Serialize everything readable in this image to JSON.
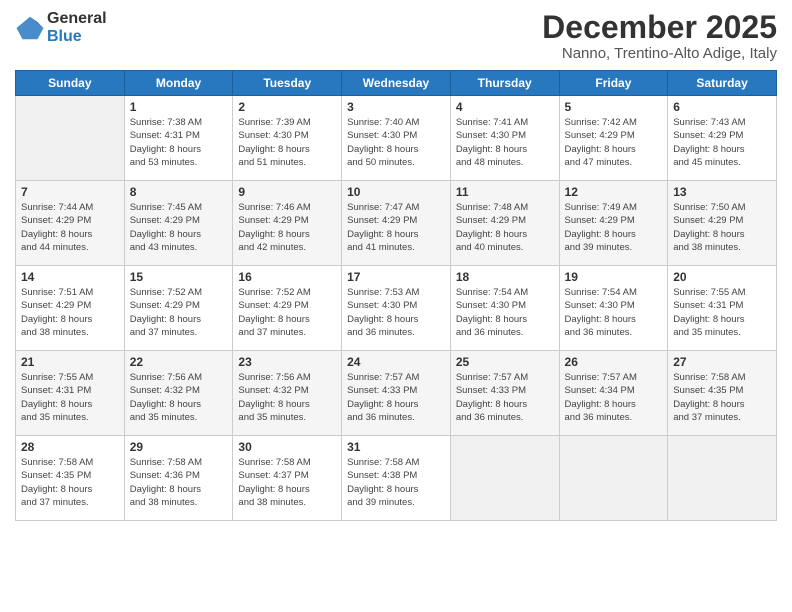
{
  "logo": {
    "general": "General",
    "blue": "Blue"
  },
  "header": {
    "title": "December 2025",
    "subtitle": "Nanno, Trentino-Alto Adige, Italy"
  },
  "weekdays": [
    "Sunday",
    "Monday",
    "Tuesday",
    "Wednesday",
    "Thursday",
    "Friday",
    "Saturday"
  ],
  "weeks": [
    [
      {
        "day": "",
        "info": ""
      },
      {
        "day": "1",
        "info": "Sunrise: 7:38 AM\nSunset: 4:31 PM\nDaylight: 8 hours\nand 53 minutes."
      },
      {
        "day": "2",
        "info": "Sunrise: 7:39 AM\nSunset: 4:30 PM\nDaylight: 8 hours\nand 51 minutes."
      },
      {
        "day": "3",
        "info": "Sunrise: 7:40 AM\nSunset: 4:30 PM\nDaylight: 8 hours\nand 50 minutes."
      },
      {
        "day": "4",
        "info": "Sunrise: 7:41 AM\nSunset: 4:30 PM\nDaylight: 8 hours\nand 48 minutes."
      },
      {
        "day": "5",
        "info": "Sunrise: 7:42 AM\nSunset: 4:29 PM\nDaylight: 8 hours\nand 47 minutes."
      },
      {
        "day": "6",
        "info": "Sunrise: 7:43 AM\nSunset: 4:29 PM\nDaylight: 8 hours\nand 45 minutes."
      }
    ],
    [
      {
        "day": "7",
        "info": "Sunrise: 7:44 AM\nSunset: 4:29 PM\nDaylight: 8 hours\nand 44 minutes."
      },
      {
        "day": "8",
        "info": "Sunrise: 7:45 AM\nSunset: 4:29 PM\nDaylight: 8 hours\nand 43 minutes."
      },
      {
        "day": "9",
        "info": "Sunrise: 7:46 AM\nSunset: 4:29 PM\nDaylight: 8 hours\nand 42 minutes."
      },
      {
        "day": "10",
        "info": "Sunrise: 7:47 AM\nSunset: 4:29 PM\nDaylight: 8 hours\nand 41 minutes."
      },
      {
        "day": "11",
        "info": "Sunrise: 7:48 AM\nSunset: 4:29 PM\nDaylight: 8 hours\nand 40 minutes."
      },
      {
        "day": "12",
        "info": "Sunrise: 7:49 AM\nSunset: 4:29 PM\nDaylight: 8 hours\nand 39 minutes."
      },
      {
        "day": "13",
        "info": "Sunrise: 7:50 AM\nSunset: 4:29 PM\nDaylight: 8 hours\nand 38 minutes."
      }
    ],
    [
      {
        "day": "14",
        "info": "Sunrise: 7:51 AM\nSunset: 4:29 PM\nDaylight: 8 hours\nand 38 minutes."
      },
      {
        "day": "15",
        "info": "Sunrise: 7:52 AM\nSunset: 4:29 PM\nDaylight: 8 hours\nand 37 minutes."
      },
      {
        "day": "16",
        "info": "Sunrise: 7:52 AM\nSunset: 4:29 PM\nDaylight: 8 hours\nand 37 minutes."
      },
      {
        "day": "17",
        "info": "Sunrise: 7:53 AM\nSunset: 4:30 PM\nDaylight: 8 hours\nand 36 minutes."
      },
      {
        "day": "18",
        "info": "Sunrise: 7:54 AM\nSunset: 4:30 PM\nDaylight: 8 hours\nand 36 minutes."
      },
      {
        "day": "19",
        "info": "Sunrise: 7:54 AM\nSunset: 4:30 PM\nDaylight: 8 hours\nand 36 minutes."
      },
      {
        "day": "20",
        "info": "Sunrise: 7:55 AM\nSunset: 4:31 PM\nDaylight: 8 hours\nand 35 minutes."
      }
    ],
    [
      {
        "day": "21",
        "info": "Sunrise: 7:55 AM\nSunset: 4:31 PM\nDaylight: 8 hours\nand 35 minutes."
      },
      {
        "day": "22",
        "info": "Sunrise: 7:56 AM\nSunset: 4:32 PM\nDaylight: 8 hours\nand 35 minutes."
      },
      {
        "day": "23",
        "info": "Sunrise: 7:56 AM\nSunset: 4:32 PM\nDaylight: 8 hours\nand 35 minutes."
      },
      {
        "day": "24",
        "info": "Sunrise: 7:57 AM\nSunset: 4:33 PM\nDaylight: 8 hours\nand 36 minutes."
      },
      {
        "day": "25",
        "info": "Sunrise: 7:57 AM\nSunset: 4:33 PM\nDaylight: 8 hours\nand 36 minutes."
      },
      {
        "day": "26",
        "info": "Sunrise: 7:57 AM\nSunset: 4:34 PM\nDaylight: 8 hours\nand 36 minutes."
      },
      {
        "day": "27",
        "info": "Sunrise: 7:58 AM\nSunset: 4:35 PM\nDaylight: 8 hours\nand 37 minutes."
      }
    ],
    [
      {
        "day": "28",
        "info": "Sunrise: 7:58 AM\nSunset: 4:35 PM\nDaylight: 8 hours\nand 37 minutes."
      },
      {
        "day": "29",
        "info": "Sunrise: 7:58 AM\nSunset: 4:36 PM\nDaylight: 8 hours\nand 38 minutes."
      },
      {
        "day": "30",
        "info": "Sunrise: 7:58 AM\nSunset: 4:37 PM\nDaylight: 8 hours\nand 38 minutes."
      },
      {
        "day": "31",
        "info": "Sunrise: 7:58 AM\nSunset: 4:38 PM\nDaylight: 8 hours\nand 39 minutes."
      },
      {
        "day": "",
        "info": ""
      },
      {
        "day": "",
        "info": ""
      },
      {
        "day": "",
        "info": ""
      }
    ]
  ]
}
